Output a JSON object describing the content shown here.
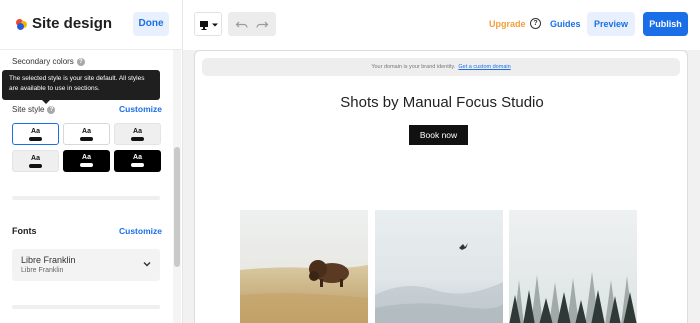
{
  "sidebar": {
    "title": "Site design",
    "done_label": "Done",
    "secondary_colors_label": "Secondary colors",
    "help_glyph": "?",
    "tooltip": "The selected style is your site default. All styles are available to use in sections.",
    "site_style_label": "Site style",
    "site_style_customize": "Customize",
    "style_tiles": [
      {
        "label": "Aa",
        "variant": "light",
        "selected": true
      },
      {
        "label": "Aa",
        "variant": "light",
        "selected": false
      },
      {
        "label": "Aa",
        "variant": "gray",
        "selected": false
      },
      {
        "label": "Aa",
        "variant": "gray",
        "selected": false
      },
      {
        "label": "Aa",
        "variant": "dark",
        "selected": false
      },
      {
        "label": "Aa",
        "variant": "dark",
        "selected": false
      }
    ],
    "fonts_label": "Fonts",
    "fonts_customize": "Customize",
    "font_select": {
      "name": "Libre Franklin",
      "sub": "Libre Franklin"
    }
  },
  "toolbar": {
    "device_icon": "desktop-icon",
    "undo_icon": "undo-icon",
    "redo_icon": "redo-icon",
    "upgrade_label": "Upgrade",
    "help_glyph": "?",
    "guides_label": "Guides",
    "preview_label": "Preview",
    "publish_label": "Publish"
  },
  "canvas": {
    "domain_text": "Your domain is your brand identity.",
    "domain_link": "Get a custom domain",
    "site_title": "Shots by Manual Focus Studio",
    "book_label": "Book now",
    "photos": [
      "bison-photo",
      "misty-lake-photo",
      "foggy-forest-photo"
    ]
  },
  "colors": {
    "accent": "#1a6fe8",
    "upgrade": "#f0a03a",
    "tooltip_bg": "#1f1f1f"
  }
}
